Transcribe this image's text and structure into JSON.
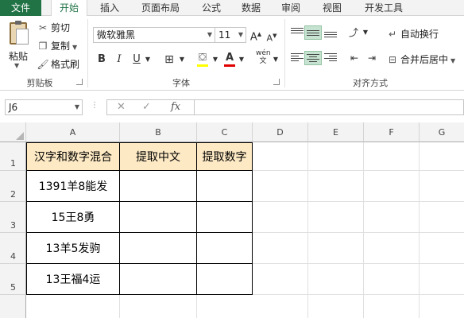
{
  "ribbon_tabs": [
    "文件",
    "开始",
    "插入",
    "页面布局",
    "公式",
    "数据",
    "审阅",
    "视图",
    "开发工具"
  ],
  "clipboard": {
    "paste_label": "粘贴",
    "cut_label": "剪切",
    "copy_label": "复制",
    "format_painter_label": "格式刷",
    "group_label": "剪贴板"
  },
  "font": {
    "font_name": "微软雅黑",
    "font_size": "11",
    "grow_label": "A",
    "shrink_label": "A",
    "bold": "B",
    "italic": "I",
    "underline": "U",
    "group_label": "字体"
  },
  "alignment": {
    "wrap_text_label": "自动换行",
    "merge_center_label": "合并后居中",
    "group_label": "对齐方式"
  },
  "formula_bar": {
    "name_box": "J6",
    "fx_label": "fx",
    "formula": ""
  },
  "sheet": {
    "columns": [
      "A",
      "B",
      "C",
      "D",
      "E",
      "F",
      "G"
    ],
    "rows": [
      "1",
      "2",
      "3",
      "4",
      "5"
    ],
    "table_headers": [
      "汉字和数字混合",
      "提取中文",
      "提取数字"
    ],
    "table_rows": [
      [
        "1391羊8能发",
        "",
        ""
      ],
      [
        "15王8勇",
        "",
        ""
      ],
      [
        "13羊5发驹",
        "",
        ""
      ],
      [
        "13王福4运",
        "",
        ""
      ]
    ]
  },
  "colors": {
    "file_tab": "#217346",
    "header_fill": "#fde9c4",
    "selected_align": "#c5e3d0"
  }
}
